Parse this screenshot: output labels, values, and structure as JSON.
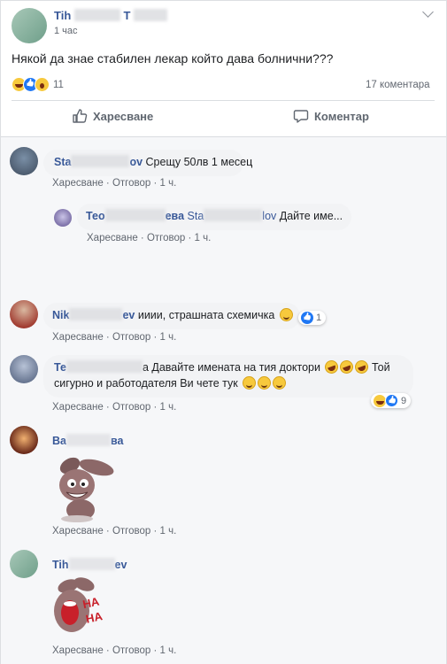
{
  "post": {
    "author_visible_1": "Tih",
    "author_visible_2": "T",
    "time": "1 час",
    "text": "Някой да знае стабилен лекар който дава болнични???",
    "reaction_count": "11",
    "comments_count": "17 коментара",
    "like_label": "Харесване",
    "comment_label": "Коментар"
  },
  "comments": [
    {
      "name_start": "Sta",
      "name_end": "ov",
      "text": "Срещу 50лв 1 месец",
      "like": "Харесване",
      "reply": "Отговор",
      "time": "1 ч."
    },
    {
      "name_start": "Тео",
      "name_mid": "ева",
      "mention_start": "Sta",
      "mention_end": "lov",
      "text": "Дайте име...",
      "like": "Харесване",
      "reply": "Отговор",
      "time": "1 ч."
    },
    {
      "name_start": "Nik",
      "name_end": "ev",
      "text": "ииии, страшната схемичка",
      "reaction_count": "1",
      "like": "Харесване",
      "reply": "Отговор",
      "time": "1 ч."
    },
    {
      "name_start": "Те",
      "text_line1_end": "а Давайте имената на тия доктори",
      "text_line1_tail": "Той",
      "text_line2": "сигурно и работодателя Ви чете тук",
      "reaction_count": "9",
      "like": "Харесване",
      "reply": "Отговор",
      "time": "1 ч."
    },
    {
      "name_start": "Ва",
      "name_end": "ва",
      "like": "Харесване",
      "reply": "Отговор",
      "time": "1 ч."
    },
    {
      "name_start": "Tih",
      "name_end": "ev",
      "sticker_text": "HA HA",
      "like": "Харесване",
      "reply": "Отговор",
      "time": "1 ч."
    }
  ],
  "colors": {
    "link": "#385898",
    "like_blue": "#2078f4",
    "bubble": "#f2f3f5",
    "meta": "#616770"
  },
  "icons": [
    "chevron-down-icon",
    "thumbs-up-icon",
    "speech-bubble-icon",
    "haha-reaction-icon",
    "like-reaction-icon",
    "wow-reaction-icon",
    "grin-emoji-icon",
    "laughing-emoji-icon",
    "sticker-bunny-icon"
  ]
}
